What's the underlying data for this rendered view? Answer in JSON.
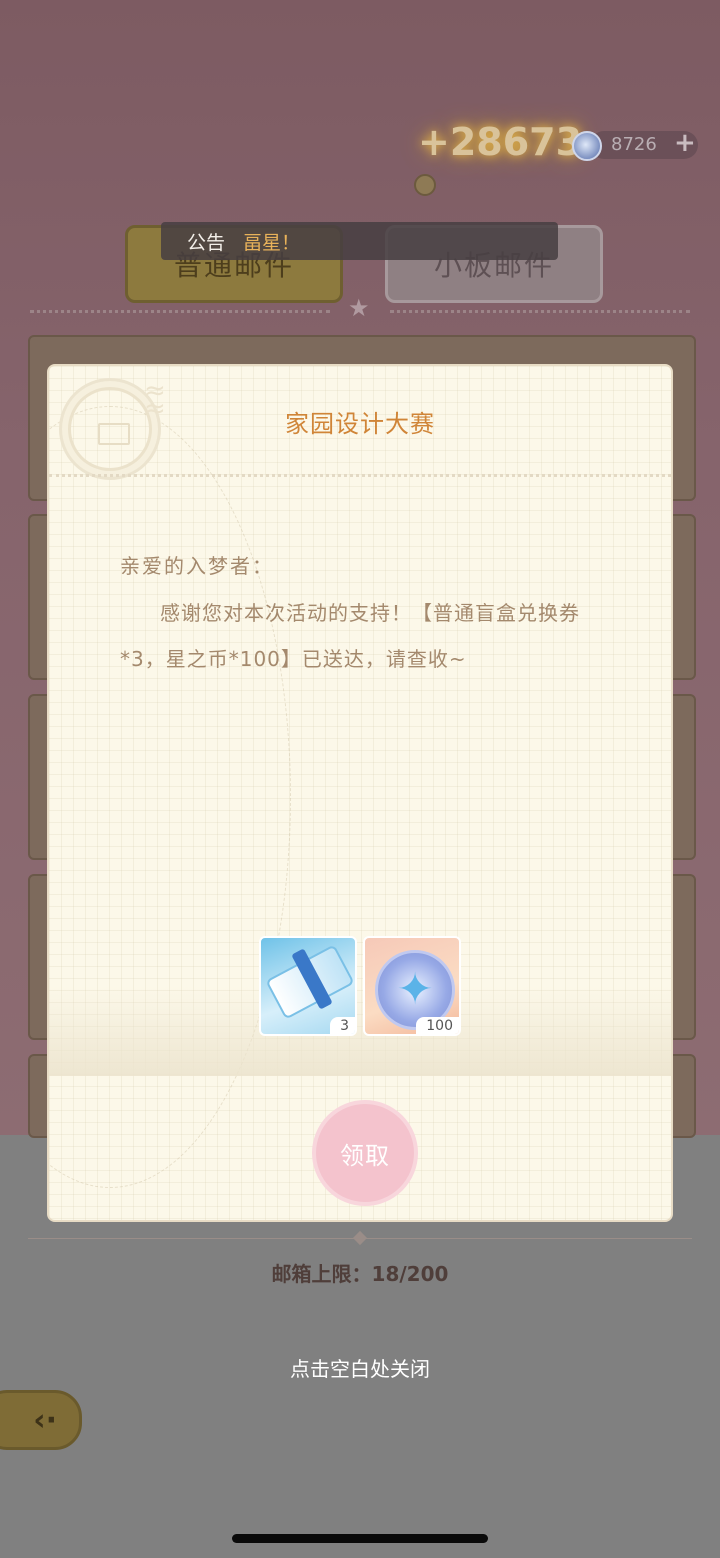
{
  "header": {
    "gain_text": "+28673",
    "star_coin_value": "8726",
    "plus_label": "+"
  },
  "tabs": [
    {
      "label": "普通邮件"
    },
    {
      "label": "小板邮件"
    }
  ],
  "announcement": {
    "label": "公告",
    "message": "畐星！"
  },
  "modal": {
    "title": "家园设计大赛",
    "greeting": "亲爱的入梦者：",
    "body": "感谢您对本次活动的支持！【普通盲盒兑换券*3，星之币*100】已送达，请查收~",
    "rewards": [
      {
        "icon": "blind-box-ticket-icon",
        "qty": "3"
      },
      {
        "icon": "star-coin-icon",
        "qty": "100"
      }
    ],
    "claim_label": "领取"
  },
  "footer": {
    "capacity": "邮箱上限：18/200",
    "close_hint": "点击空白处关闭",
    "back_icon": "back-arrow-icon"
  },
  "colors": {
    "title": "#d08538",
    "body_text": "#a4896d",
    "claim_button": "#f4c3cd"
  }
}
